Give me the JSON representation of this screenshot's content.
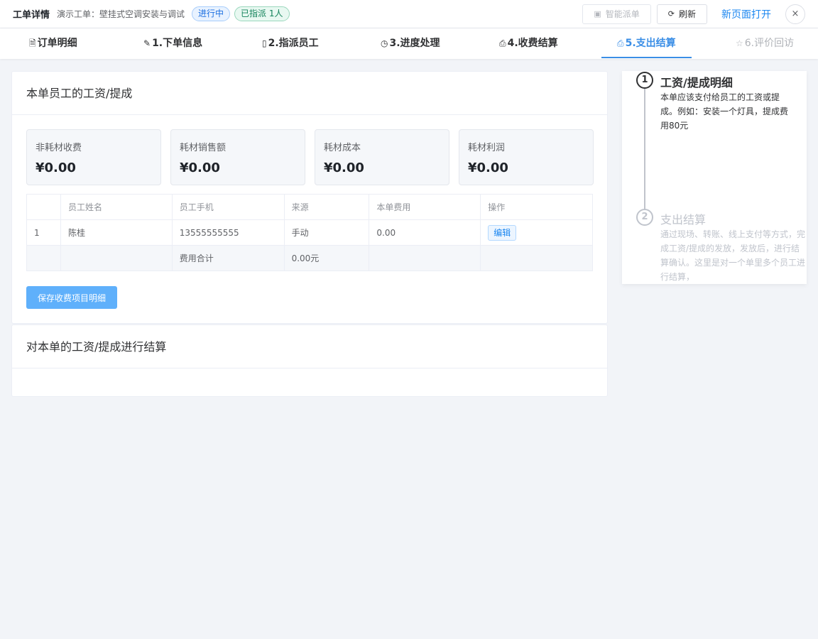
{
  "header": {
    "title": "工单详情",
    "subtitle": "演示工单：壁挂式空调安装与调试",
    "status_tag": "进行中",
    "assign_tag": "已指派 1人",
    "smart_dispatch_label": "智能派单",
    "refresh_label": "刷新",
    "open_new_page_label": "新页面打开",
    "close_icon": "×"
  },
  "tabs": [
    {
      "icon": "🗎",
      "label": "订单明细"
    },
    {
      "icon": "✎",
      "label": "1.下单信息"
    },
    {
      "icon": "▯",
      "label": "2.指派员工"
    },
    {
      "icon": "◷",
      "label": "3.进度处理"
    },
    {
      "icon": "⎙",
      "label": "4.收费结算"
    },
    {
      "icon": "⎙",
      "label": "5.支出结算"
    },
    {
      "icon": "☆",
      "label": "6.评价回访"
    }
  ],
  "wage_section": {
    "title": "本单员工的工资/提成",
    "stats": [
      {
        "label": "非耗材收费",
        "value": "¥0.00"
      },
      {
        "label": "耗材销售额",
        "value": "¥0.00"
      },
      {
        "label": "耗材成本",
        "value": "¥0.00"
      },
      {
        "label": "耗材利润",
        "value": "¥0.00"
      }
    ],
    "table": {
      "headers": [
        "",
        "员工姓名",
        "员工手机",
        "来源",
        "本单费用",
        "操作"
      ],
      "rows": [
        {
          "index": "1",
          "name": "陈桂",
          "phone": "13555555555",
          "source": "手动",
          "fee": "0.00",
          "action": "编辑"
        }
      ],
      "summary": {
        "label": "费用合计",
        "value": "0.00元"
      }
    },
    "save_label": "保存收费项目明细"
  },
  "settle_section": {
    "title": "对本单的工资/提成进行结算"
  },
  "steps": [
    {
      "num": "1",
      "title": "工资/提成明细",
      "desc": "本单应该支付给员工的工资或提成。例如：安装一个灯具，提成费用80元"
    },
    {
      "num": "2",
      "title": "支出结算",
      "desc": "通过现场、转账、线上支付等方式，完成工资/提成的发放，发放后，进行结算确认。这里是对一个单里多个员工进行结算，"
    }
  ],
  "colors": {
    "accent": "#3a8ee6",
    "save_button": "#5fb0fb"
  }
}
